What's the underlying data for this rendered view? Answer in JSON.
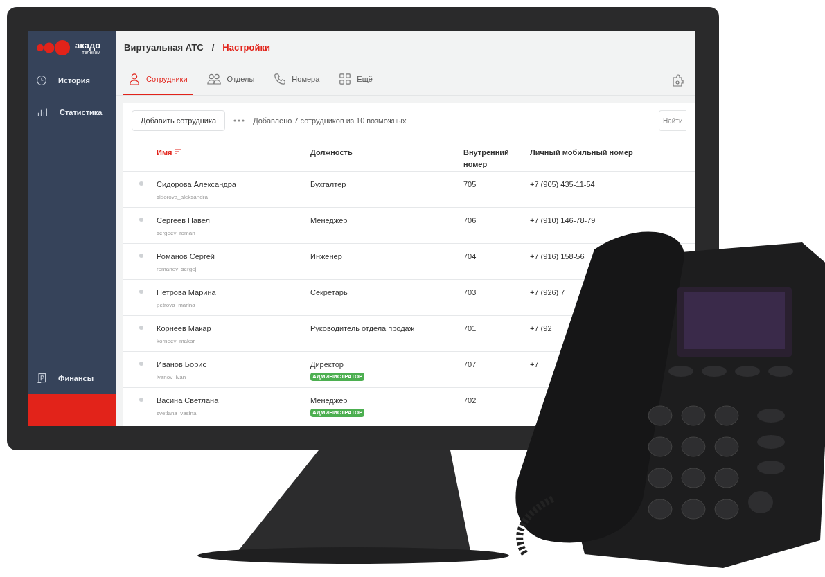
{
  "logo": {
    "name": "акадо",
    "sub": "телеком"
  },
  "sidebar": {
    "items": [
      {
        "label": "История",
        "selected": false
      },
      {
        "label": "Статистика",
        "selected": false
      }
    ],
    "bottom_items": [
      {
        "label": "Финансы",
        "selected": false
      },
      {
        "selected": true
      }
    ]
  },
  "breadcrumb": [
    {
      "label": "Виртуальная АТС",
      "current": false
    },
    {
      "label": "Настройки",
      "current": true
    }
  ],
  "breadcrumb_separator": "/",
  "tabs": [
    {
      "label": "Сотрудники",
      "selected": true
    },
    {
      "label": "Отделы",
      "selected": false
    },
    {
      "label": "Номера",
      "selected": false
    },
    {
      "label": "Ещё",
      "selected": false
    }
  ],
  "toolbar": {
    "add_button": "Добавить сотрудника",
    "summary": "Добавлено 7 сотрудников из 10 возможных",
    "search": {
      "placeholder": "Найти"
    }
  },
  "table": {
    "columns": [
      {
        "label": "Имя",
        "sorted": true
      },
      {
        "label": "Должность",
        "sorted": false
      },
      {
        "label": "Внутренний номер",
        "sorted": false
      },
      {
        "label": "Личный мобильный номер",
        "sorted": false
      }
    ],
    "rows": [
      {
        "name": "Сидорова Александра",
        "login": "sidorova_aleksandra",
        "position": "Бухгалтер",
        "ext": "705",
        "mobile": "+7 (905) 435-11-54"
      },
      {
        "name": "Сергеев Павел",
        "login": "sergeev_roman",
        "position": "Менеджер",
        "ext": "706",
        "mobile": "+7 (910) 146-78-79"
      },
      {
        "name": "Романов Сергей",
        "login": "romanov_sergej",
        "position": "Инженер",
        "ext": "704",
        "mobile": "+7 (916) 158-56"
      },
      {
        "name": "Петрова Марина",
        "login": "petrova_marina",
        "position": "Секретарь",
        "ext": "703",
        "mobile": "+7 (926) 7"
      },
      {
        "name": "Корнеев Макар",
        "login": "korneev_makar",
        "position": "Руководитель отдела продаж",
        "ext": "701",
        "mobile": "+7 (92"
      },
      {
        "name": "Иванов Борис",
        "login": "ivanov_ivan",
        "position": "Директор",
        "badge": "АДМИНИСТРАТОР",
        "ext": "707",
        "mobile": "+7"
      },
      {
        "name": "Васина Светлана",
        "login": "svetlana_vasina",
        "position": "Менеджер",
        "badge": "АДМИНИСТРАТОР",
        "ext": "702"
      }
    ]
  }
}
